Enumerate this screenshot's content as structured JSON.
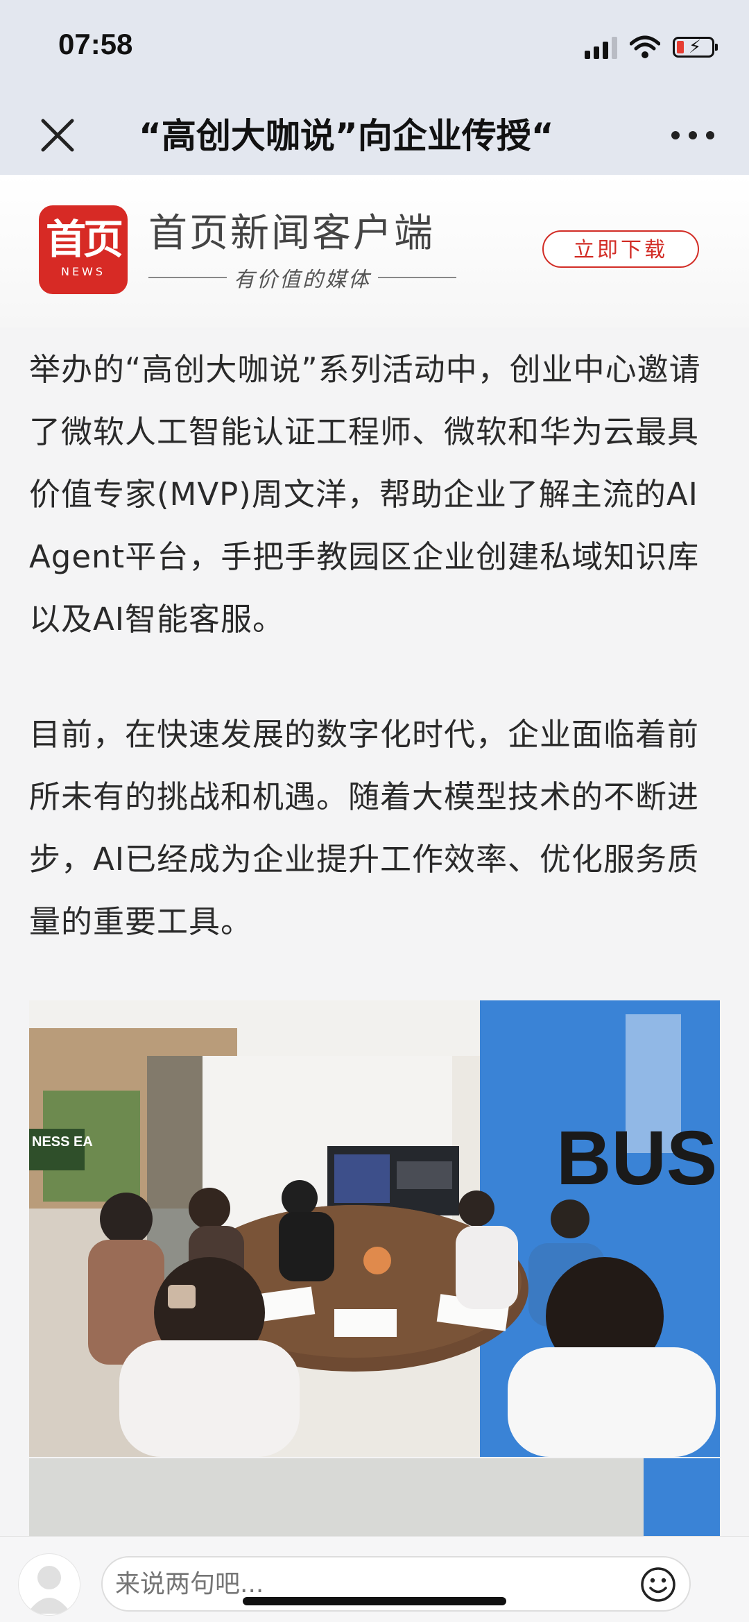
{
  "status_bar": {
    "time": "07:58"
  },
  "nav": {
    "title": "“高创大咖说”向企业传授“"
  },
  "banner": {
    "logo_text": "首页",
    "logo_subtext": "NEWS",
    "app_name": "首页新闻客户端",
    "slogan": "有价值的媒体",
    "download_label": "立即下载"
  },
  "article": {
    "paragraphs": [
      "举办的“高创大咖说”系列活动中，创业中心邀请了微软人工智能认证工程师、微软和华为云最具价值专家(MVP)周文洋，帮助企业了解主流的AI Agent平台，手把手教园区企业创建私域知识库以及AI智能客服。",
      "目前，在快速发展的数字化时代，企业面临着前所未有的挑战和机遇。随着大模型技术的不断进步，AI已经成为企业提升工作效率、优化服务质量的重要工具。"
    ],
    "photo_wall_text": "BUSI",
    "photo_wall_text_left": "NESS EA"
  },
  "comment": {
    "placeholder": "来说两句吧..."
  },
  "icons": {
    "close": "close-icon",
    "more": "more-icon",
    "signal": "signal-icon",
    "wifi": "wifi-icon",
    "battery": "battery-charging-icon",
    "avatar": "user-avatar-icon",
    "emoji": "emoji-icon"
  },
  "colors": {
    "brand_red": "#d72a25",
    "nav_bg": "#e3e7ef",
    "wall_blue": "#3a83d6"
  }
}
